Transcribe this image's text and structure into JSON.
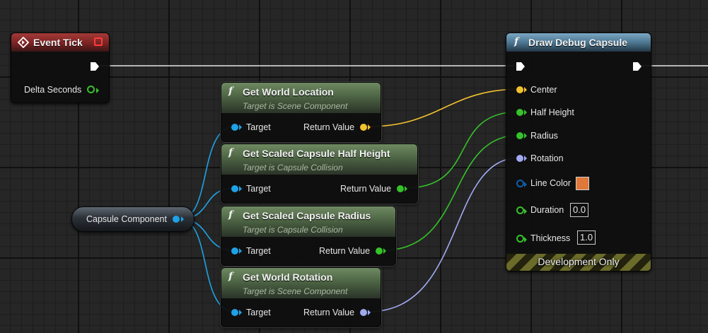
{
  "event_tick": {
    "title": "Event Tick",
    "delta_label": "Delta Seconds"
  },
  "capsule_var": {
    "label": "Capsule Component"
  },
  "get_world_location": {
    "title": "Get World Location",
    "subtitle": "Target is Scene Component",
    "target_label": "Target",
    "return_label": "Return Value"
  },
  "get_half_height": {
    "title": "Get Scaled Capsule Half Height",
    "subtitle": "Target is Capsule Collision",
    "target_label": "Target",
    "return_label": "Return Value"
  },
  "get_radius": {
    "title": "Get Scaled Capsule Radius",
    "subtitle": "Target is Capsule Collision",
    "target_label": "Target",
    "return_label": "Return Value"
  },
  "get_world_rotation": {
    "title": "Get World Rotation",
    "subtitle": "Target is Scene Component",
    "target_label": "Target",
    "return_label": "Return Value"
  },
  "draw_debug_capsule": {
    "title": "Draw Debug Capsule",
    "pins": {
      "center": "Center",
      "half_height": "Half Height",
      "radius": "Radius",
      "rotation": "Rotation",
      "line_color": "Line Color",
      "duration": "Duration",
      "thickness": "Thickness"
    },
    "duration_value": "0.0",
    "thickness_value": "1.0",
    "line_color_swatch": "#e0783a",
    "footer": "Development Only"
  },
  "icons": {
    "function_icon": "f",
    "event_icon": "diamond-arrow",
    "close_icon": "red-square"
  },
  "colors": {
    "vector_pin": "#f2c12e",
    "float_pin": "#35c22a",
    "rotator_pin": "#a0aaf2",
    "object_pin": "#1ea2e6",
    "color_pin": "#0d5fa8",
    "exec_pin": "#ffffff"
  }
}
